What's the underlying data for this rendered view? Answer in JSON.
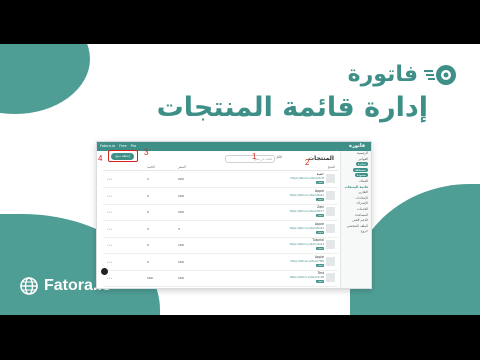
{
  "brand": {
    "name": "فاتورة",
    "footer": "Fatora.io"
  },
  "headline": "إدارة قائمة المنتجات",
  "colors": {
    "teal": "#3d8f87",
    "blob": "#4f9e96",
    "annotation": "#d9221f"
  },
  "app": {
    "topbar": {
      "left_items": [
        "Fatora.io",
        "Free",
        "Pro"
      ],
      "logo": "فاتورة"
    },
    "sidebar": [
      {
        "label": "الرئيسية"
      },
      {
        "label": "الفواتير"
      },
      {
        "label": "صادرة"
      },
      {
        "label": "مستحقة"
      },
      {
        "label": "مسودة"
      },
      {
        "label": "العملاء"
      },
      {
        "label": "قائمة المنتجات",
        "active": true
      },
      {
        "label": "التقارير"
      },
      {
        "label": "الإعدادات"
      },
      {
        "label": "الإشتراك"
      },
      {
        "label": "الخدمات"
      },
      {
        "label": "المساعدة"
      },
      {
        "label": "الدعم الفني"
      },
      {
        "label": "الملف الشخصي"
      },
      {
        "label": "خروج"
      }
    ],
    "page_title": "المنتجات",
    "search_placeholder": "ابحث عن منتج",
    "filter_label": "الكل",
    "add_button": "إضافة منتج",
    "columns": [
      "المنتج",
      "السعر",
      "الكمية"
    ],
    "rows": [
      {
        "name": "حقيبة",
        "url": "https://fatora.io/item/4c3f",
        "tag": "متوفر",
        "price": "200",
        "qty": "1"
      },
      {
        "name": "Apple",
        "url": "https://fatora.io/item/8a21",
        "tag": "متوفر",
        "price": "100",
        "qty": "2"
      },
      {
        "name": "Zaki",
        "url": "https://fatora.io/item/5b77",
        "tag": "متوفر",
        "price": "200",
        "qty": "5"
      },
      {
        "name": "Apple",
        "url": "https://fatora.io/item/9d12",
        "tag": "متوفر",
        "price": "3",
        "qty": "3"
      },
      {
        "name": "Tutorial",
        "url": "https://fatora.io/item/2e44",
        "tag": "متوفر",
        "price": "100",
        "qty": "2"
      },
      {
        "name": "Apple",
        "url": "https://fatora.io/item/7f90",
        "tag": "متوفر",
        "price": "100",
        "qty": "2"
      },
      {
        "name": "Test",
        "url": "https://fatora.io/item/1c08",
        "tag": "متوفر",
        "price": "100",
        "qty": "100"
      }
    ],
    "annotations": [
      "1",
      "2",
      "3",
      "4"
    ]
  }
}
